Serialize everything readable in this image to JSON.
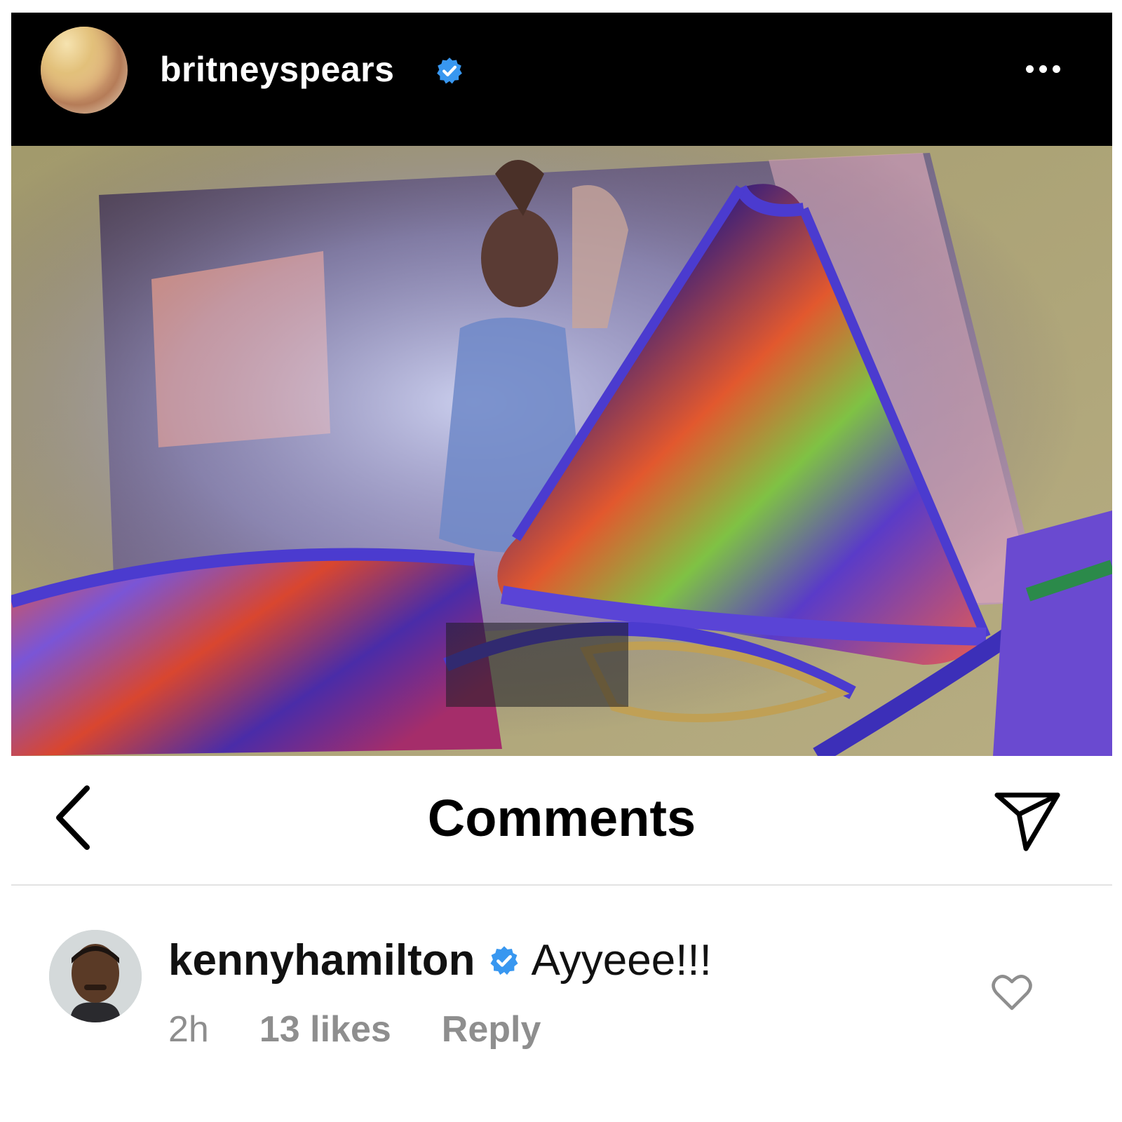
{
  "post": {
    "username": "britneyspears",
    "verified": true,
    "more_icon": "more-horizontal-icon"
  },
  "comments_bar": {
    "title": "Comments",
    "back_icon": "chevron-left-icon",
    "share_icon": "send-icon"
  },
  "comment": {
    "username": "kennyhamilton",
    "verified": true,
    "text": "Ayyeee!!!",
    "time": "2h",
    "likes": "13 likes",
    "reply_label": "Reply",
    "like_icon": "heart-outline-icon"
  },
  "colors": {
    "header_bg": "#000000",
    "verified_blue": "#3897f0",
    "meta_gray": "#8e8e8e"
  }
}
